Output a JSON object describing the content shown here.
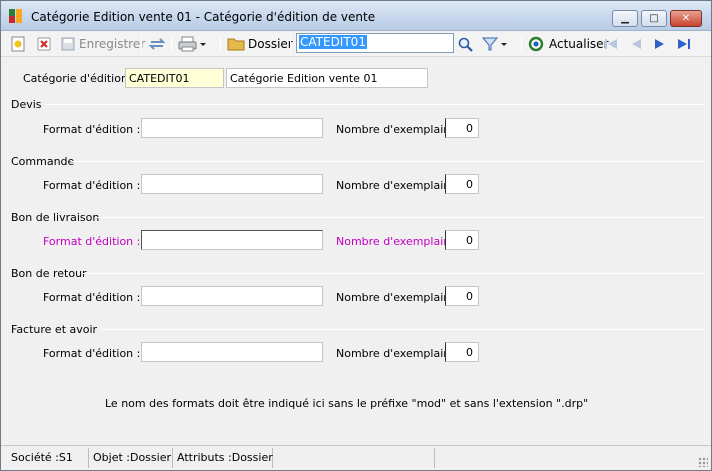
{
  "window": {
    "title": "Catégorie Edition vente 01 -  Catégorie d'édition de vente",
    "minimize_symbol": "▁",
    "maximize_symbol": "□",
    "close_symbol": "✕"
  },
  "toolbar": {
    "new_icon": "new-document-icon",
    "delete_icon": "delete-icon",
    "save_label": "Enregistrer",
    "dossier_label": "Dossier",
    "search_value": "CATEDIT01",
    "refresh_label": "Actualiser"
  },
  "header": {
    "category_label": "Catégorie d'édition :",
    "category_code": "CATEDIT01",
    "category_name": "Catégorie Edition vente 01"
  },
  "sections": [
    {
      "title": "Devis",
      "format_label": "Format d'édition :",
      "format_value": "",
      "copies_label": "Nombre d'exemplaires :",
      "copies_value": "0"
    },
    {
      "title": "Commande",
      "format_label": "Format d'édition :",
      "format_value": "",
      "copies_label": "Nombre d'exemplaires :",
      "copies_value": "0"
    },
    {
      "title": "Bon de livraison",
      "format_label": "Format d'édition :",
      "format_value": "",
      "copies_label": "Nombre d'exemplaires :",
      "copies_value": "0"
    },
    {
      "title": "Bon de retour",
      "format_label": "Format d'édition :",
      "format_value": "",
      "copies_label": "Nombre d'exemplaires :",
      "copies_value": "0"
    },
    {
      "title": "Facture et avoir",
      "format_label": "Format d'édition :",
      "format_value": "",
      "copies_label": "Nombre d'exemplaires :",
      "copies_value": "0"
    }
  ],
  "note": "Le nom des formats doit être indiqué ici sans le préfixe \"mod\" et sans l'extension \".drp\"",
  "statusbar": {
    "societe": "Société :S1",
    "objet": "Objet :Dossier",
    "attributs": "Attributs :Dossier"
  },
  "colors": {
    "highlight_label": "#c000c0",
    "code_field_bg": "#ffffd8",
    "selection": "#3399ff"
  }
}
